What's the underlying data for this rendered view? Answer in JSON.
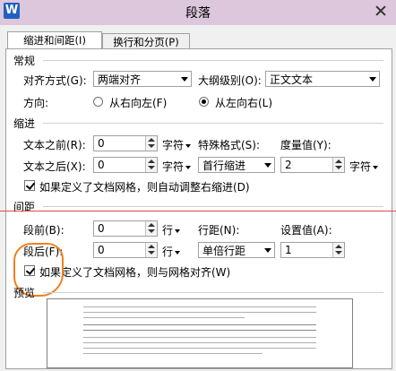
{
  "window": {
    "title": "段落",
    "app_icon_letter": "W"
  },
  "tabs": [
    {
      "label": "缩进和间距(I)"
    },
    {
      "label": "换行和分页(P)"
    }
  ],
  "general": {
    "heading": "常规",
    "alignment_label": "对齐方式(G):",
    "alignment_value": "两端对齐",
    "outline_label": "大纲级别(O):",
    "outline_value": "正文文本",
    "direction_label": "方向:",
    "rtl_label": "从右向左(F)",
    "ltr_label": "从左向右(L)",
    "direction_selected": "ltr"
  },
  "indent": {
    "heading": "缩进",
    "before_label": "文本之前(R):",
    "before_value": "0",
    "before_unit": "字符",
    "after_label": "文本之后(X):",
    "after_value": "0",
    "after_unit": "字符",
    "special_label": "特殊格式(S):",
    "special_value": "首行缩进",
    "measure_label": "度量值(Y):",
    "measure_value": "2",
    "measure_unit": "字符",
    "auto_adjust_label": "如果定义了文档网格，则自动调整右缩进(D)",
    "auto_adjust_checked": true
  },
  "spacing": {
    "heading": "间距",
    "before_label": "段前(B):",
    "before_value": "0",
    "before_unit": "行",
    "after_label": "段后(F):",
    "after_value": "0",
    "after_unit": "行",
    "line_label": "行距(N):",
    "line_value": "单倍行距",
    "setting_label": "设置值(A):",
    "setting_value": "1",
    "snap_grid_label": "如果定义了文档网格，则与网格对齐(W)",
    "snap_grid_checked": true
  },
  "preview": {
    "heading": "预览"
  },
  "colors": {
    "annotation_line": "#e04848",
    "annotation_circle": "#f08020",
    "titlebar": "#dcc7dc"
  }
}
